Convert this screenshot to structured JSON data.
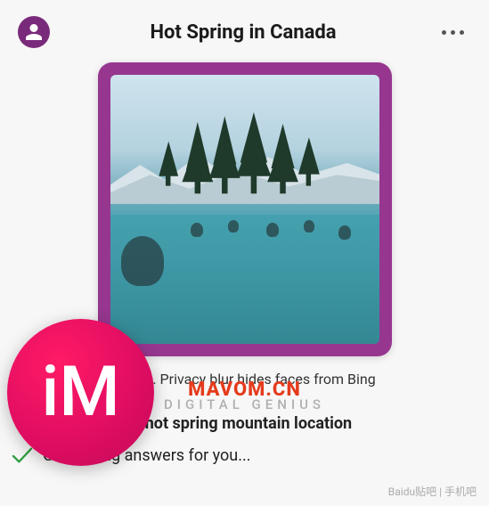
{
  "header": {
    "title": "Hot Spring in Canada"
  },
  "image": {
    "alt": "hot-spring-pool-mountains"
  },
  "caption": {
    "text_full": "image. Privacy blur hides faces from Bing"
  },
  "divider_label": "DIGITAL GENIUS",
  "query": {
    "prefix": ": ",
    "text": "hot spring mountain location"
  },
  "status": {
    "text": "Generating answers for you..."
  },
  "overlay": {
    "badge_text": "iM",
    "watermark_main": "MAVOM.CN",
    "watermark_corner": "Baidu贴吧 | 手机吧"
  }
}
